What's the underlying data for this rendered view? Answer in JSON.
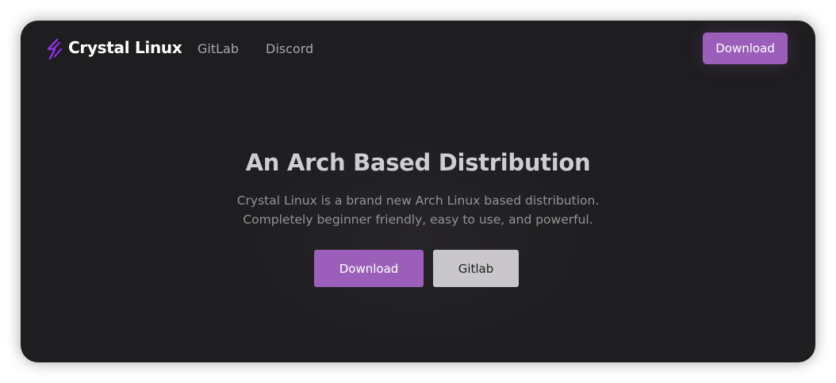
{
  "nav": {
    "brand": "Crystal Linux",
    "brand_icon": "crystal-logo-icon",
    "links": [
      "GitLab",
      "Discord"
    ],
    "download_label": "Download"
  },
  "hero": {
    "title": "An Arch Based Distribution",
    "subtitle_line1": "Crystal Linux is a brand new Arch Linux based distribution.",
    "subtitle_line2": "Completely beginner friendly, easy to use, and powerful.",
    "primary_button": "Download",
    "secondary_button": "Gitlab"
  },
  "colors": {
    "background": "#1e1d1f",
    "accent": "#9b5fba",
    "secondary_button": "#c9c7ca",
    "logo": "#8b2fe0"
  }
}
